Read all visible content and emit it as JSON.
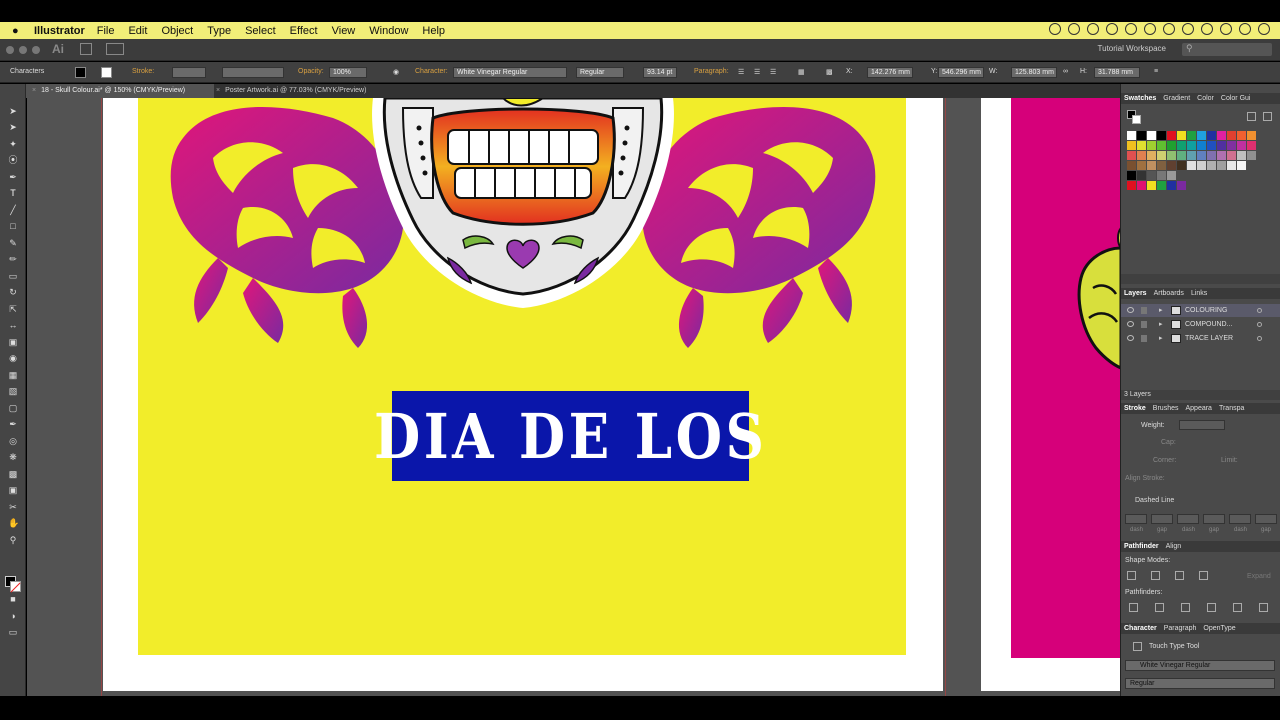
{
  "menubar": {
    "app_name": "Illustrator",
    "items": [
      "File",
      "Edit",
      "Object",
      "Type",
      "Select",
      "Effect",
      "View",
      "Window",
      "Help"
    ]
  },
  "appbar": {
    "app_logo": "Ai",
    "workspace": "Tutorial Workspace"
  },
  "control_bar": {
    "panel_label": "Characters",
    "stroke_label": "Stroke:",
    "opacity_label": "Opacity:",
    "opacity_value": "100%",
    "character_label": "Character:",
    "font": "White Vinegar Regular",
    "style": "Regular",
    "size": "93.14 pt",
    "paragraph_label": "Paragraph:",
    "x_label": "X:",
    "x_value": "142.276 mm",
    "y_label": "Y:",
    "y_value": "546.296 mm",
    "w_label": "W:",
    "w_value": "125.803 mm",
    "h_label": "H:",
    "h_value": "31.788 mm"
  },
  "tabs": [
    {
      "label": "18 - Skull Colour.ai* @ 150% (CMYK/Preview)",
      "active": true
    },
    {
      "label": "Poster Artwork.ai @ 77.03% (CMYK/Preview)",
      "active": false
    }
  ],
  "artboard": {
    "title_text": "DIA DE LOS"
  },
  "panels": {
    "swatch_tabs": [
      "Swatches",
      "Gradient",
      "Color",
      "Color Gui"
    ],
    "layer_tabs": [
      "Layers",
      "Artboards",
      "Links"
    ],
    "layers": [
      "COLOURING",
      "COMPOUND...",
      "TRACE LAYER"
    ],
    "layers_count": "3 Layers",
    "stroke_tabs": [
      "Stroke",
      "Brushes",
      "Appeara",
      "Transpa"
    ],
    "weight_label": "Weight:",
    "cap_label": "Cap:",
    "corner_label": "Corner:",
    "limit_label": "Limit:",
    "align_stroke_label": "Align Stroke:",
    "dashed_line_label": "Dashed Line",
    "dash_labels": [
      "dash",
      "gap",
      "dash",
      "gap",
      "dash",
      "gap"
    ],
    "pathfinder_tabs": [
      "Pathfinder",
      "Align"
    ],
    "shape_modes_label": "Shape Modes:",
    "expand_label": "Expand",
    "pathfinders_label": "Pathfinders:",
    "character_tabs": [
      "Character",
      "Paragraph",
      "OpenType"
    ],
    "touch_type_tool": "Touch Type Tool",
    "font": "White Vinegar Regular",
    "style": "Regular"
  },
  "colors": {
    "menubar_bg": "#f2ee78",
    "poster_yellow": "#f2ed2a",
    "poster_magenta": "#d6007a",
    "title_box_blue": "#0a16aa"
  }
}
